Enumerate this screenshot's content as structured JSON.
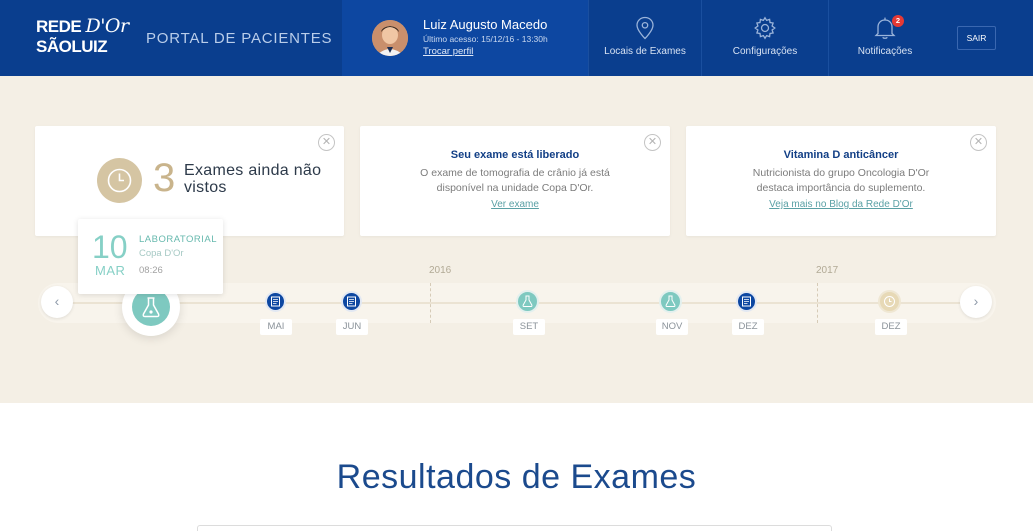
{
  "header": {
    "logo_line1": "REDE",
    "logo_dor": "D'Or",
    "logo_line2": "SÃOLUIZ",
    "portal_title": "PORTAL DE PACIENTES",
    "user": {
      "name": "Luiz Augusto Macedo",
      "last_access": "Último acesso: 15/12/16 - 13:30h",
      "switch_profile": "Trocar perfil"
    },
    "nav": [
      {
        "label": "Locais de Exames",
        "icon": "map-pin-icon"
      },
      {
        "label": "Configurações",
        "icon": "gear-icon"
      },
      {
        "label": "Notificações",
        "icon": "bell-icon",
        "badge": "2"
      }
    ],
    "logout_label": "SAIR",
    "colors": {
      "header_bg": "#0a3e8e",
      "user_panel_bg": "#0d47a1",
      "badge": "#e53935"
    }
  },
  "cards": {
    "unseen": {
      "count": "3",
      "label": "Exames ainda não vistos",
      "close": "✕"
    },
    "released": {
      "title": "Seu exame está liberado",
      "body": "O exame de tomografia de crânio já está disponível na unidade Copa D'Or.",
      "link": "Ver exame",
      "close": "✕"
    },
    "vitamin": {
      "title": "Vitamina D anticâncer",
      "body": "Nutricionista do grupo Oncologia D'Or destaca importância do suplemento.",
      "link": "Veja mais no Blog da Rede D'Or",
      "close": "✕"
    }
  },
  "timeline": {
    "years": [
      "2016",
      "2017"
    ],
    "prev": "‹",
    "next": "›",
    "tooltip": {
      "day": "10",
      "month": "MAR",
      "type": "LABORATORIAL",
      "unit": "Copa D'Or",
      "time": "08:26"
    },
    "events": [
      {
        "month": "",
        "kind": "lab-active"
      },
      {
        "month": "MAI",
        "kind": "document"
      },
      {
        "month": "JUN",
        "kind": "document"
      },
      {
        "month": "SET",
        "kind": "lab"
      },
      {
        "month": "NOV",
        "kind": "lab"
      },
      {
        "month": "DEZ",
        "kind": "document"
      },
      {
        "month": "DEZ",
        "kind": "pending"
      }
    ]
  },
  "results": {
    "title": "Resultados de Exames"
  }
}
